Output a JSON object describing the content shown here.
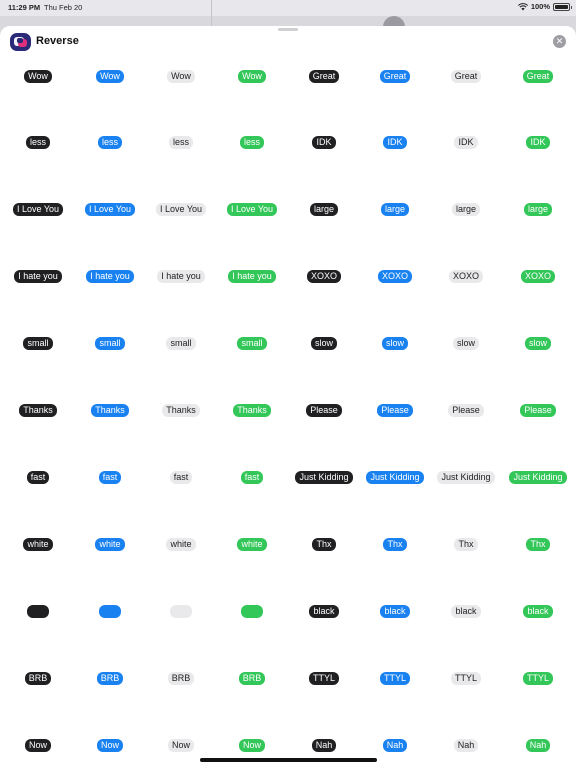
{
  "status_bar": {
    "time": "11:29 PM",
    "date": "Thu Feb 20",
    "battery": "100%",
    "battery_level": 1.0
  },
  "header": {
    "app_title": "Reverse",
    "close_symbol": "✕"
  },
  "sticker_styles": [
    "dark",
    "blue",
    "light",
    "green"
  ],
  "colors": {
    "dark": "#202022",
    "blue": "#1a82f0",
    "light": "#e9e9eb",
    "green": "#33c659"
  },
  "stickers": {
    "rows": [
      [
        "Wow",
        "Great"
      ],
      [
        "less",
        "IDK"
      ],
      [
        "I Love You",
        "large"
      ],
      [
        "I hate you",
        "XOXO"
      ],
      [
        "small",
        "slow"
      ],
      [
        "Thanks",
        "Please"
      ],
      [
        "fast",
        "Just Kidding"
      ],
      [
        "white",
        "Thx"
      ],
      [
        "",
        "black"
      ],
      [
        "BRB",
        "TTYL"
      ],
      [
        "Now",
        "Nah"
      ]
    ]
  }
}
